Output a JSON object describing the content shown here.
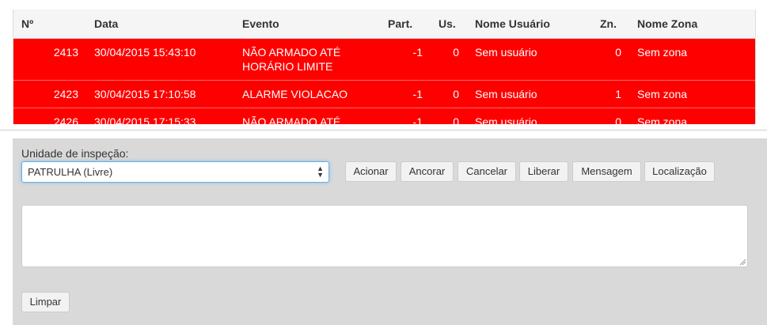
{
  "table": {
    "headers": [
      "Nº",
      "Data",
      "Evento",
      "Part.",
      "Us.",
      "Nome Usuário",
      "Zn.",
      "Nome Zona"
    ],
    "rows": [
      {
        "n": "2413",
        "data": "30/04/2015 15:43:10",
        "evento": "NÃO ARMADO ATÉ HORÁRIO LIMITE",
        "part": "-1",
        "us": "0",
        "usuario": "Sem usuário",
        "zn": "0",
        "zona": "Sem zona"
      },
      {
        "n": "2423",
        "data": "30/04/2015 17:10:58",
        "evento": "ALARME VIOLACAO",
        "part": "-1",
        "us": "0",
        "usuario": "Sem usuário",
        "zn": "1",
        "zona": "Sem zona"
      },
      {
        "n": "2426",
        "data": "30/04/2015 17:15:33",
        "evento": "NÃO ARMADO ATÉ",
        "part": "-1",
        "us": "0",
        "usuario": "Sem usuário",
        "zn": "0",
        "zona": "Sem zona"
      }
    ],
    "row_color": "#ff0000"
  },
  "form": {
    "unit_label": "Unidade de inspeção:",
    "unit_selected": "PATRULHA (Livre)",
    "buttons": [
      "Acionar",
      "Ancorar",
      "Cancelar",
      "Liberar",
      "Mensagem",
      "Localização"
    ],
    "message_value": "",
    "clear_label": "Limpar"
  }
}
